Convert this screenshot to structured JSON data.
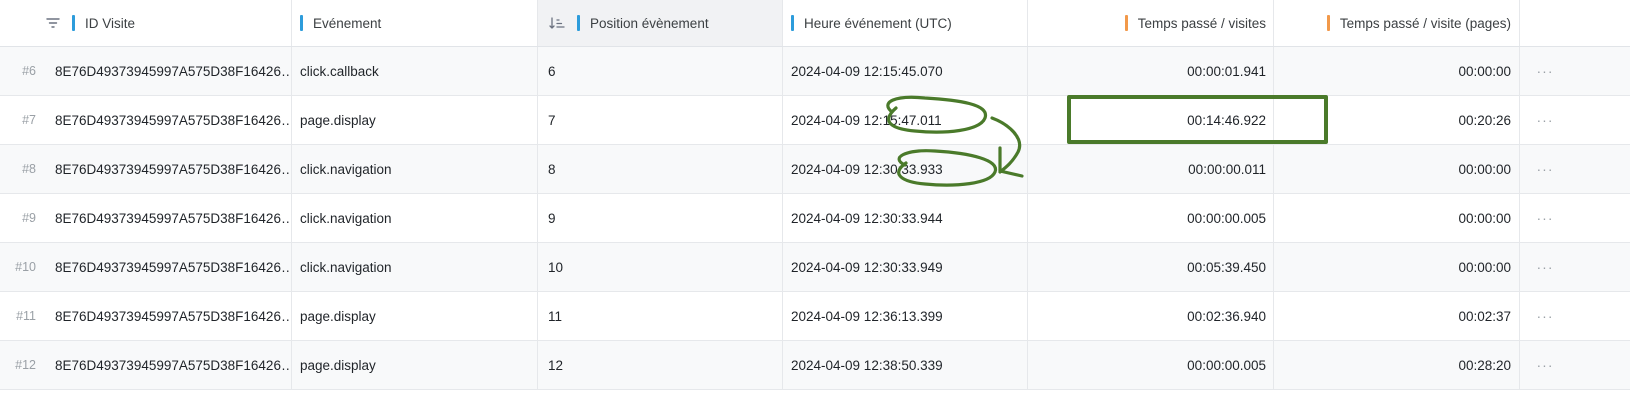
{
  "columns": [
    {
      "label": "ID Visite",
      "bar": "blue"
    },
    {
      "label": "Evénement",
      "bar": "blue"
    },
    {
      "label": "Position évènement",
      "bar": "blue"
    },
    {
      "label": "Heure événement (UTC)",
      "bar": "blue"
    },
    {
      "label": "Temps passé / visites",
      "bar": "orange"
    },
    {
      "label": "Temps passé / visite (pages)",
      "bar": "orange"
    }
  ],
  "icons": {
    "filter": "filter-icon",
    "sort": "sort-ascending-icon",
    "more": "more-options-icon"
  },
  "colors": {
    "blue_bar": "#2d9cdb",
    "orange_bar": "#f2994a",
    "annotation": "#4a7a2a"
  },
  "rows": [
    {
      "index": "#6",
      "id": "8E76D49373945997A575D38F16426…",
      "event": "click.callback",
      "position": "6",
      "time": "2024-04-09 12:15:45.070",
      "tpv": "00:00:01.941",
      "tpp": "00:00:00",
      "more": "···"
    },
    {
      "index": "#7",
      "id": "8E76D49373945997A575D38F16426…",
      "event": "page.display",
      "position": "7",
      "time": "2024-04-09 12:15:47.011",
      "tpv": "00:14:46.922",
      "tpp": "00:20:26",
      "more": "···"
    },
    {
      "index": "#8",
      "id": "8E76D49373945997A575D38F16426…",
      "event": "click.navigation",
      "position": "8",
      "time": "2024-04-09 12:30:33.933",
      "tpv": "00:00:00.011",
      "tpp": "00:00:00",
      "more": "···"
    },
    {
      "index": "#9",
      "id": "8E76D49373945997A575D38F16426…",
      "event": "click.navigation",
      "position": "9",
      "time": "2024-04-09 12:30:33.944",
      "tpv": "00:00:00.005",
      "tpp": "00:00:00",
      "more": "···"
    },
    {
      "index": "#10",
      "id": "8E76D49373945997A575D38F16426…",
      "event": "click.navigation",
      "position": "10",
      "time": "2024-04-09 12:30:33.949",
      "tpv": "00:05:39.450",
      "tpp": "00:00:00",
      "more": "···"
    },
    {
      "index": "#11",
      "id": "8E76D49373945997A575D38F16426…",
      "event": "page.display",
      "position": "11",
      "time": "2024-04-09 12:36:13.399",
      "tpv": "00:02:36.940",
      "tpp": "00:02:37",
      "more": "···"
    },
    {
      "index": "#12",
      "id": "8E76D49373945997A575D38F16426…",
      "event": "page.display",
      "position": "12",
      "time": "2024-04-09 12:38:50.339",
      "tpv": "00:00:00.005",
      "tpp": "00:28:20",
      "more": "···"
    }
  ]
}
